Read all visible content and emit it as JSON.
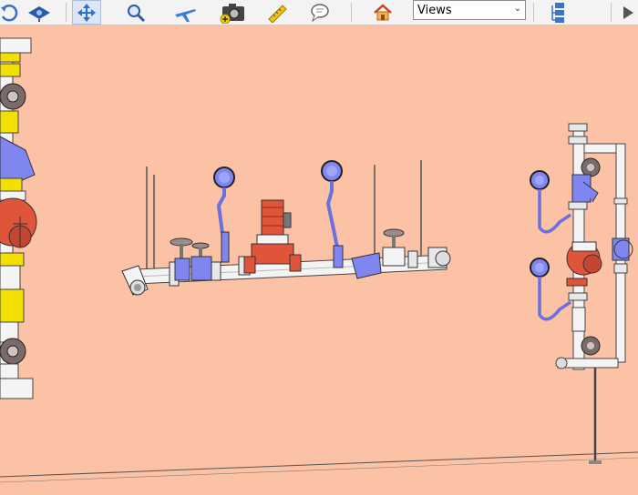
{
  "toolbar": {
    "buttons": [
      {
        "name": "rotate-icon"
      },
      {
        "name": "view-orientation-icon"
      },
      {
        "name": "pan-icon"
      },
      {
        "name": "zoom-icon"
      },
      {
        "name": "fly-icon"
      },
      {
        "name": "camera-icon"
      },
      {
        "name": "measure-icon"
      },
      {
        "name": "comment-icon"
      },
      {
        "name": "home-icon"
      },
      {
        "name": "model-tree-icon"
      },
      {
        "name": "play-icon"
      }
    ],
    "views_select": {
      "value": "Views",
      "options": [
        "Views"
      ]
    }
  },
  "colors": {
    "background": "#fcc2a6",
    "pipe": "#f4f4f4",
    "valve_blue": "#7f86f0",
    "pump_red": "#e0543a",
    "fitting_yellow": "#f2e000",
    "toolbar": "#f3f3f3"
  }
}
